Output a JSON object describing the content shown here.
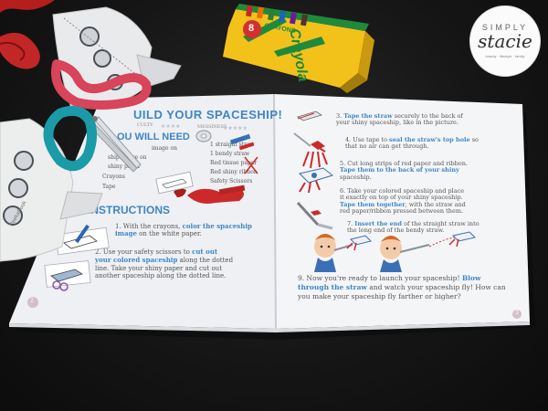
{
  "watermark": {
    "line1": "SIMPLY",
    "line2": "stacie",
    "line3": "beauty · lifestyle · family"
  },
  "crayon_box": {
    "count": "8",
    "brand_small": "CRAYONS",
    "brand": "Crayola"
  },
  "cutout": {
    "label": "PeekaBook"
  },
  "left_page": {
    "title": "UILD YOUR SPACESHIP!",
    "difficulty_left": "CULTY",
    "difficulty_right": "MESSINESS",
    "need_heading": "OU WILL NEED",
    "supplies_left": [
      "ship image on",
      "shiny paper",
      "Crayons",
      "Tape"
    ],
    "supplies_left_fragment": "image on",
    "supplies_right": [
      "1 straight straw",
      "1 bendy straw",
      "Red tissue paper",
      "Red shiny ribbon",
      "Safety Scissors"
    ],
    "instructions_heading": "INSTRUCTIONS",
    "step1": {
      "lead": "1. With the crayons, ",
      "highlight": "color the spaceship",
      "highlight2": "image",
      "rest": " on the white paper."
    },
    "step2": {
      "lead": "2. Use your safety scissors to ",
      "highlight": "cut out",
      "highlight2": "your colored spaceship",
      "rest": " along the dotted",
      "line3": "line. Take your shiny paper and cut out",
      "line4": "another spaceship along the dotted line."
    },
    "page_number": "2"
  },
  "right_page": {
    "step3": {
      "lead": "3. ",
      "highlight": "Tape the straw",
      "line1_rest": " securely to the back of",
      "line2": "your shiny spaceship, like in the picture."
    },
    "step4": {
      "lead": "4. Use tape to ",
      "highlight": "seal the straw's top hole",
      "line1_rest": " so",
      "line2": "that no air can get through."
    },
    "step5": {
      "line1": "5. Cut long strips of red paper and ribbon.",
      "highlight": "Tape them to the back of your shiny",
      "line3": "spaceship."
    },
    "step6": {
      "line1": "6. Take your colored spaceship and place",
      "line2": "it exactly on top of your shiny spaceship.",
      "highlight": "Tape them together",
      "line3_rest": ", with the straw and",
      "line4": "red paper/ribbon pressed between them."
    },
    "step7": {
      "lead": "7. ",
      "highlight": "Insert the end",
      "line1_rest": " of the straight straw into",
      "line2": "the long end of the bendy straw."
    },
    "step9": {
      "lead": "9. Now you're ready to launch your spaceship! ",
      "highlight": "Blow",
      "highlight2": "through the straw",
      "line2_rest": " and watch your spaceship fly! How can",
      "line3": "you make your spaceship fly farther or higher?"
    },
    "page_number": "3"
  },
  "colors": {
    "page": "#f3f4f6",
    "heading_blue": "#3f86c6",
    "body_text": "#555555",
    "red": "#cc2a2a",
    "crayon_yellow": "#f2c21b",
    "crayon_green": "#1f8a3b",
    "scissor_red": "#d8445a",
    "scissor_teal": "#1b9aa8"
  }
}
